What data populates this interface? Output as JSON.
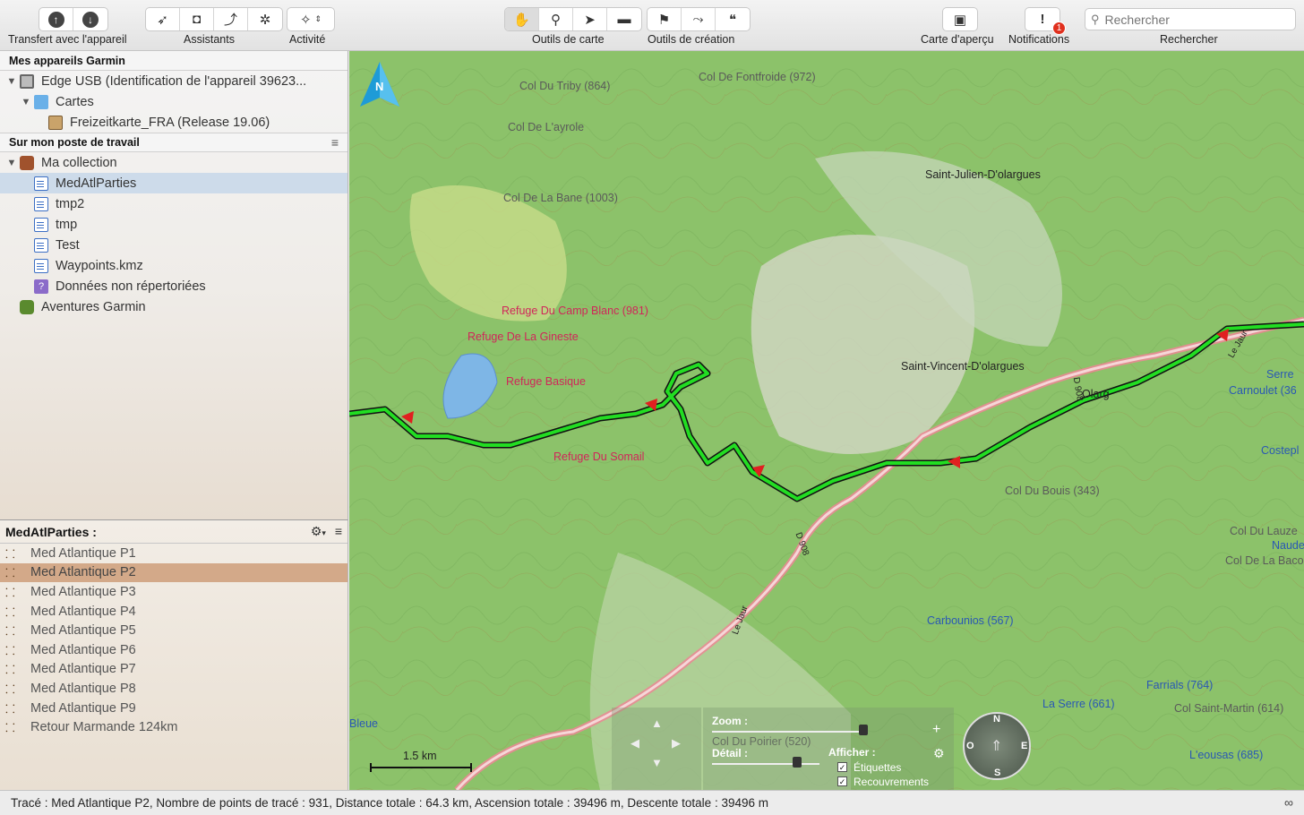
{
  "toolbar": {
    "groups": [
      {
        "label": "Transfert avec l'appareil"
      },
      {
        "label": "Assistants"
      },
      {
        "label": "Activité"
      },
      {
        "label": "Outils de carte"
      },
      {
        "label": "Outils de création"
      },
      {
        "label": "Carte d'aperçu"
      },
      {
        "label": "Notifications",
        "badge": "1"
      },
      {
        "label": "Rechercher"
      }
    ],
    "search_placeholder": "Rechercher"
  },
  "sidebar": {
    "devices_header": "Mes appareils Garmin",
    "device": "Edge USB (Identification de l'appareil 39623...",
    "maps_folder": "Cartes",
    "map_item": "Freizeitkarte_FRA (Release 19.06)",
    "workstation_header": "Sur mon poste de travail",
    "collection": "Ma collection",
    "items": [
      {
        "label": "MedAtlParties",
        "selected": true
      },
      {
        "label": "tmp2"
      },
      {
        "label": "tmp"
      },
      {
        "label": "Test"
      },
      {
        "label": "Waypoints.kmz"
      },
      {
        "label": "Données non répertoriées"
      }
    ],
    "adventures": "Aventures Garmin"
  },
  "list": {
    "header": "MedAtlParties :",
    "rows": [
      "Med Atlantique P1",
      "Med Atlantique P2",
      "Med Atlantique P3",
      "Med Atlantique P4",
      "Med Atlantique P5",
      "Med Atlantique P6",
      "Med Atlantique P7",
      "Med Atlantique P8",
      "Med Atlantique P9",
      "Retour Marmande 124km"
    ],
    "selected_index": 1
  },
  "map": {
    "north": "N",
    "places": {
      "col_triby": "Col Du Triby (864)",
      "col_fontfroide": "Col De Fontfroide (972)",
      "col_layrole": "Col De L'ayrole",
      "col_bane": "Col De La Bane (1003)",
      "st_julien": "Saint-Julien-D'olargues",
      "refuge_campblanc": "Refuge Du Camp Blanc (981)",
      "refuge_gineste": "Refuge De La Gineste",
      "refuge_basique": "Refuge Basique",
      "refuge_somail": "Refuge Du Somail",
      "st_vincent": "Saint-Vincent-D'olargues",
      "olargues": "Olarg",
      "serre": "Serre",
      "carnoulet": "Carnoulet (36",
      "costeple": "Costepl",
      "col_bouis": "Col Du Bouis (343)",
      "col_lauzet": "Col Du Lauze",
      "naude": "Naude",
      "col_baco": "Col De La Baco",
      "carbounios": "Carbounios (567)",
      "col_poirier": "Col Du Poirier (520)",
      "farrials": "Farrials (764)",
      "la_serre": "La Serre (661)",
      "col_st_martin": "Col Saint-Martin (614)",
      "leousas": "L'eousas (685)",
      "bleue": "Bleue",
      "d908": "D 908",
      "le_jaur": "Le Jaur"
    },
    "scale": "1.5 km",
    "zoom_label": "Zoom :",
    "detail_label": "Détail :",
    "show_label": "Afficher :",
    "labels_check": "Étiquettes",
    "overlays_check": "Recouvrements",
    "compass": {
      "n": "N",
      "s": "S",
      "e": "E",
      "w": "O"
    }
  },
  "status": {
    "text": "Tracé : Med Atlantique P2, Nombre de points de tracé : 931, Distance totale : 64.3 km, Ascension totale : 39496 m, Descente totale : 39496 m"
  }
}
